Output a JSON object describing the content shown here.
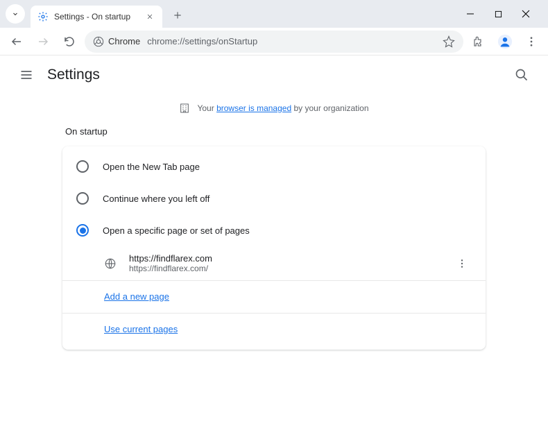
{
  "window": {
    "tab_title": "Settings - On startup"
  },
  "toolbar": {
    "chrome_chip": "Chrome",
    "url": "chrome://settings/onStartup"
  },
  "header": {
    "title": "Settings"
  },
  "banner": {
    "prefix": "Your ",
    "link": "browser is managed",
    "suffix": " by your organization"
  },
  "section": {
    "title": "On startup",
    "options": [
      {
        "label": "Open the New Tab page",
        "selected": false
      },
      {
        "label": "Continue where you left off",
        "selected": false
      },
      {
        "label": "Open a specific page or set of pages",
        "selected": true
      }
    ],
    "page": {
      "display": "https://findflarex.com",
      "full": "https://findflarex.com/"
    },
    "add_page": "Add a new page",
    "use_current": "Use current pages"
  }
}
